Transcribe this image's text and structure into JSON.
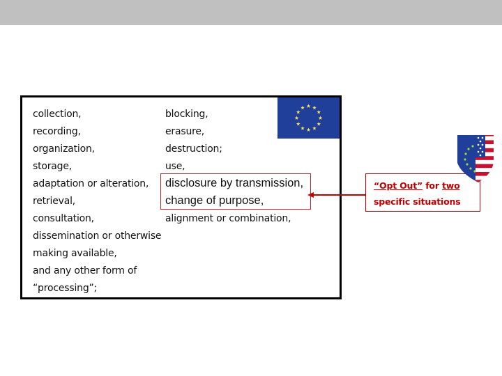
{
  "slide": {
    "colors": {
      "band": "#c0c0c0",
      "accent_red": "#c00000",
      "eu_blue": "#1f3f9b",
      "eu_star": "#f2e25a"
    },
    "left_column": [
      "collection,",
      "recording,",
      "organization,",
      "storage,",
      "adaptation or alteration,",
      "retrieval,",
      "consultation,",
      "dissemination or otherwise",
      "making available,",
      "and any other form of",
      "“processing”;"
    ],
    "right_column": [
      "blocking,",
      "erasure,",
      "destruction;",
      "use,",
      "disclosure by transmission,",
      "change of purpose,",
      "alignment or combination,"
    ],
    "highlighted_items": [
      "disclosure by transmission,",
      "change of purpose,"
    ],
    "callout": {
      "opt_out": "“Opt Out”",
      "for": " for ",
      "two": "two",
      "line2": "specific situations"
    },
    "icons": {
      "eu_flag": "eu-flag-icon",
      "privacy_shield": "privacy-shield-icon",
      "arrow": "arrow-left-icon"
    }
  }
}
